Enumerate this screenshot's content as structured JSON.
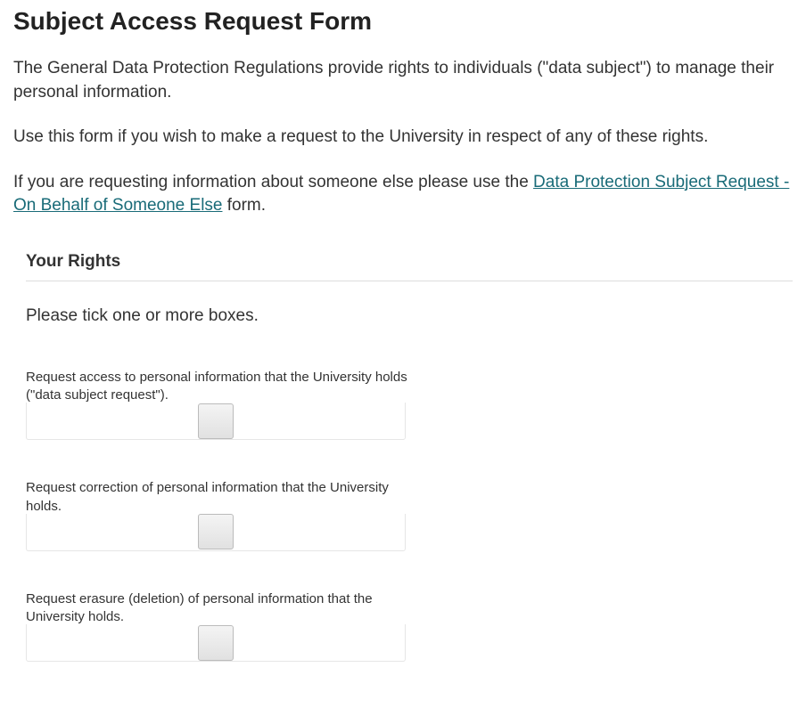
{
  "page_title": "Subject Access Request Form",
  "intro_paragraphs": {
    "p1": "The General Data Protection Regulations provide rights to individuals (\"data subject\") to manage their personal information.",
    "p2": "Use this form if you wish to make a request to the University in respect of any of these rights.",
    "p3_prefix": "If you are requesting information about someone else please use the ",
    "p3_link": "Data Protection Subject Request - On Behalf of Someone Else",
    "p3_suffix": " form."
  },
  "section": {
    "title": "Your Rights",
    "description": "Please tick one or more boxes.",
    "fields": [
      {
        "label": "Request access to personal information that the University holds (\"data subject request\")."
      },
      {
        "label": "Request correction of personal information that the University holds."
      },
      {
        "label": "Request erasure (deletion) of personal information that the University holds."
      }
    ]
  }
}
